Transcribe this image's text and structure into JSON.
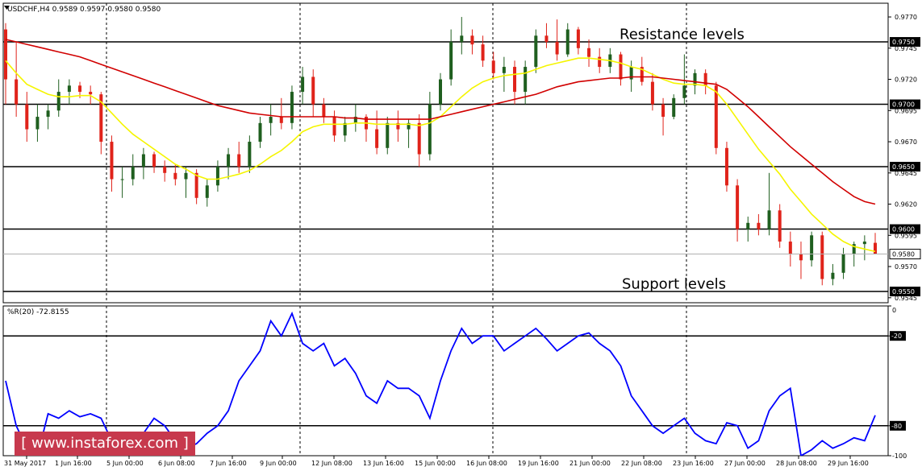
{
  "chart_data": [
    {
      "type": "candlestick",
      "title": "USDCHF,H4 0.9589 0.9597 0.9580 0.9580",
      "ylim": [
        0.9541,
        0.9781
      ],
      "yticks": [
        "0.9770",
        "0.9745",
        "0.9720",
        "0.9695",
        "0.9670",
        "0.9645",
        "0.9620",
        "0.9595",
        "0.9570",
        "0.9545"
      ],
      "xticks": [
        "31 May 2017",
        "1 Jun 16:00",
        "5 Jun 00:00",
        "6 Jun 08:00",
        "7 Jun 16:00",
        "9 Jun 00:00",
        "12 Jun 08:00",
        "13 Jun 16:00",
        "15 Jun 00:00",
        "16 Jun 08:00",
        "19 Jun 16:00",
        "21 Jun 00:00",
        "22 Jun 08:00",
        "23 Jun 16:00",
        "27 Jun 00:00",
        "28 Jun 08:00",
        "29 Jun 16:00"
      ],
      "levels": [
        {
          "value": 0.975,
          "label": "0.9750"
        },
        {
          "value": 0.97,
          "label": "0.9700"
        },
        {
          "value": 0.965,
          "label": "0.9650"
        },
        {
          "value": 0.96,
          "label": "0.9600"
        },
        {
          "value": 0.955,
          "label": "0.9550"
        }
      ],
      "current_price": {
        "value": 0.958,
        "label": "0.9580"
      },
      "annotations": [
        {
          "text": "Resistance levels",
          "price": 0.9753
        },
        {
          "text": "Support levels",
          "price": 0.9553
        }
      ],
      "candles": [
        [
          0.976,
          0.9765,
          0.97,
          0.972
        ],
        [
          0.972,
          0.975,
          0.969,
          0.97
        ],
        [
          0.97,
          0.971,
          0.967,
          0.968
        ],
        [
          0.968,
          0.97,
          0.967,
          0.969
        ],
        [
          0.969,
          0.97,
          0.968,
          0.9695
        ],
        [
          0.9695,
          0.972,
          0.969,
          0.971
        ],
        [
          0.971,
          0.972,
          0.97,
          0.9715
        ],
        [
          0.9715,
          0.9718,
          0.9705,
          0.971
        ],
        [
          0.971,
          0.9715,
          0.97,
          0.9708
        ],
        [
          0.9708,
          0.971,
          0.966,
          0.967
        ],
        [
          0.967,
          0.9675,
          0.963,
          0.964
        ],
        [
          0.964,
          0.965,
          0.9625,
          0.964
        ],
        [
          0.964,
          0.966,
          0.9635,
          0.965
        ],
        [
          0.965,
          0.9665,
          0.964,
          0.966
        ],
        [
          0.966,
          0.9662,
          0.9645,
          0.965
        ],
        [
          0.965,
          0.9655,
          0.9638,
          0.9645
        ],
        [
          0.9645,
          0.9652,
          0.9635,
          0.964
        ],
        [
          0.964,
          0.965,
          0.9625,
          0.9645
        ],
        [
          0.9645,
          0.9648,
          0.962,
          0.9625
        ],
        [
          0.9625,
          0.964,
          0.9618,
          0.9635
        ],
        [
          0.9635,
          0.9655,
          0.963,
          0.965
        ],
        [
          0.965,
          0.9665,
          0.964,
          0.966
        ],
        [
          0.966,
          0.967,
          0.9645,
          0.965
        ],
        [
          0.965,
          0.9675,
          0.9645,
          0.967
        ],
        [
          0.967,
          0.969,
          0.9665,
          0.9685
        ],
        [
          0.9685,
          0.97,
          0.9675,
          0.969
        ],
        [
          0.969,
          0.9705,
          0.968,
          0.9685
        ],
        [
          0.9685,
          0.9715,
          0.968,
          0.971
        ],
        [
          0.971,
          0.973,
          0.97,
          0.9722
        ],
        [
          0.9722,
          0.9728,
          0.969,
          0.97
        ],
        [
          0.97,
          0.9705,
          0.9685,
          0.969
        ],
        [
          0.969,
          0.9695,
          0.967,
          0.9675
        ],
        [
          0.9675,
          0.969,
          0.967,
          0.9685
        ],
        [
          0.9685,
          0.97,
          0.9678,
          0.969
        ],
        [
          0.969,
          0.9692,
          0.967,
          0.968
        ],
        [
          0.968,
          0.9695,
          0.966,
          0.9665
        ],
        [
          0.9665,
          0.969,
          0.966,
          0.9685
        ],
        [
          0.9685,
          0.9695,
          0.967,
          0.968
        ],
        [
          0.968,
          0.9688,
          0.9665,
          0.9685
        ],
        [
          0.9685,
          0.9692,
          0.965,
          0.966
        ],
        [
          0.966,
          0.971,
          0.9655,
          0.97
        ],
        [
          0.97,
          0.9725,
          0.9695,
          0.972
        ],
        [
          0.972,
          0.976,
          0.9715,
          0.975
        ],
        [
          0.975,
          0.977,
          0.974,
          0.9755
        ],
        [
          0.9755,
          0.976,
          0.974,
          0.9748
        ],
        [
          0.9748,
          0.9755,
          0.973,
          0.9735
        ],
        [
          0.9735,
          0.9742,
          0.972,
          0.9725
        ],
        [
          0.9725,
          0.9738,
          0.971,
          0.973
        ],
        [
          0.973,
          0.9735,
          0.97,
          0.971
        ],
        [
          0.971,
          0.9735,
          0.97,
          0.973
        ],
        [
          0.973,
          0.976,
          0.9725,
          0.9755
        ],
        [
          0.9755,
          0.9765,
          0.9745,
          0.975
        ],
        [
          0.975,
          0.9768,
          0.9735,
          0.974
        ],
        [
          0.974,
          0.9765,
          0.9738,
          0.976
        ],
        [
          0.976,
          0.9762,
          0.974,
          0.9745
        ],
        [
          0.9745,
          0.9752,
          0.973,
          0.9738
        ],
        [
          0.9738,
          0.9745,
          0.9725,
          0.973
        ],
        [
          0.973,
          0.9745,
          0.9725,
          0.974
        ],
        [
          0.974,
          0.9742,
          0.9715,
          0.972
        ],
        [
          0.972,
          0.9735,
          0.971,
          0.973
        ],
        [
          0.973,
          0.9738,
          0.9715,
          0.9718
        ],
        [
          0.9718,
          0.9725,
          0.9695,
          0.97
        ],
        [
          0.97,
          0.9705,
          0.9675,
          0.969
        ],
        [
          0.969,
          0.9708,
          0.9688,
          0.9705
        ],
        [
          0.9705,
          0.974,
          0.97,
          0.9715
        ],
        [
          0.9715,
          0.9728,
          0.9708,
          0.9725
        ],
        [
          0.9725,
          0.9728,
          0.9708,
          0.9715
        ],
        [
          0.9715,
          0.9718,
          0.966,
          0.9665
        ],
        [
          0.9665,
          0.967,
          0.963,
          0.9635
        ],
        [
          0.9635,
          0.964,
          0.959,
          0.96
        ],
        [
          0.96,
          0.961,
          0.959,
          0.9605
        ],
        [
          0.9605,
          0.9612,
          0.9595,
          0.96
        ],
        [
          0.96,
          0.9645,
          0.9595,
          0.9615
        ],
        [
          0.9615,
          0.962,
          0.9585,
          0.959
        ],
        [
          0.959,
          0.9598,
          0.957,
          0.958
        ],
        [
          0.958,
          0.959,
          0.956,
          0.9575
        ],
        [
          0.9575,
          0.9598,
          0.957,
          0.9595
        ],
        [
          0.9595,
          0.9598,
          0.9555,
          0.956
        ],
        [
          0.956,
          0.9572,
          0.9555,
          0.9565
        ],
        [
          0.9565,
          0.9585,
          0.956,
          0.958
        ],
        [
          0.958,
          0.959,
          0.957,
          0.9588
        ],
        [
          0.9588,
          0.9595,
          0.9575,
          0.959
        ],
        [
          0.9589,
          0.9597,
          0.958,
          0.958
        ]
      ],
      "series": [
        {
          "name": "fast MA",
          "color": "#f5f500",
          "values": [
            0.9735,
            0.9725,
            0.9716,
            0.9712,
            0.9708,
            0.9706,
            0.9706,
            0.9707,
            0.9707,
            0.9702,
            0.9693,
            0.9684,
            0.9676,
            0.967,
            0.9664,
            0.9658,
            0.9652,
            0.9648,
            0.9643,
            0.964,
            0.964,
            0.9642,
            0.9644,
            0.9647,
            0.9652,
            0.9658,
            0.9663,
            0.967,
            0.9678,
            0.9682,
            0.9684,
            0.9684,
            0.9684,
            0.9685,
            0.9685,
            0.9684,
            0.9684,
            0.9684,
            0.9684,
            0.9683,
            0.9685,
            0.969,
            0.9698,
            0.9706,
            0.9713,
            0.9718,
            0.9721,
            0.9723,
            0.9724,
            0.9725,
            0.9728,
            0.9731,
            0.9733,
            0.9735,
            0.9737,
            0.9737,
            0.9736,
            0.9735,
            0.9733,
            0.973,
            0.9728,
            0.9724,
            0.972,
            0.9717,
            0.9716,
            0.9716,
            0.9715,
            0.971,
            0.97,
            0.9688,
            0.9676,
            0.9664,
            0.9654,
            0.9644,
            0.9632,
            0.9622,
            0.9612,
            0.9604,
            0.9596,
            0.959,
            0.9586,
            0.9584,
            0.9582
          ]
        },
        {
          "name": "slow MA",
          "color": "#d10000",
          "values": [
            0.9752,
            0.975,
            0.9748,
            0.9746,
            0.9744,
            0.9742,
            0.974,
            0.9738,
            0.9735,
            0.9732,
            0.9729,
            0.9726,
            0.9723,
            0.972,
            0.9717,
            0.9714,
            0.9711,
            0.9708,
            0.9705,
            0.9702,
            0.9699,
            0.9697,
            0.9695,
            0.9693,
            0.9692,
            0.9691,
            0.969,
            0.969,
            0.969,
            0.969,
            0.969,
            0.969,
            0.9689,
            0.9689,
            0.9688,
            0.9688,
            0.9688,
            0.9688,
            0.9688,
            0.9688,
            0.9688,
            0.969,
            0.9692,
            0.9694,
            0.9696,
            0.9698,
            0.97,
            0.9702,
            0.9704,
            0.9706,
            0.9708,
            0.9711,
            0.9714,
            0.9716,
            0.9718,
            0.9719,
            0.972,
            0.9721,
            0.9721,
            0.9722,
            0.9722,
            0.9722,
            0.9721,
            0.972,
            0.9719,
            0.9718,
            0.9717,
            0.9716,
            0.9712,
            0.9705,
            0.9698,
            0.969,
            0.9682,
            0.9674,
            0.9666,
            0.9659,
            0.9652,
            0.9645,
            0.9638,
            0.9632,
            0.9626,
            0.9622,
            0.962
          ]
        }
      ]
    },
    {
      "type": "line",
      "title": "%R(20) -72.8155",
      "ylim": [
        -100,
        0
      ],
      "yticks": [
        "0",
        "-20",
        "-80",
        "-100"
      ],
      "levels": [
        {
          "value": -20,
          "label": "-20"
        },
        {
          "value": -80,
          "label": "-80"
        }
      ],
      "series": [
        {
          "name": "%R(20)",
          "color": "#0000ff",
          "values": [
            -50,
            -80,
            -95,
            -100,
            -72,
            -75,
            -70,
            -74,
            -72,
            -75,
            -90,
            -98,
            -95,
            -85,
            -75,
            -80,
            -90,
            -95,
            -92,
            -85,
            -80,
            -70,
            -50,
            -40,
            -30,
            -10,
            -20,
            -5,
            -25,
            -30,
            -25,
            -40,
            -35,
            -45,
            -60,
            -65,
            -50,
            -55,
            -55,
            -60,
            -75,
            -50,
            -30,
            -15,
            -25,
            -20,
            -20,
            -30,
            -25,
            -20,
            -15,
            -22,
            -30,
            -25,
            -20,
            -18,
            -25,
            -30,
            -40,
            -60,
            -70,
            -80,
            -85,
            -80,
            -75,
            -85,
            -90,
            -92,
            -78,
            -80,
            -95,
            -90,
            -70,
            -60,
            -55,
            -100,
            -96,
            -90,
            -95,
            -92,
            -88,
            -90,
            -73
          ]
        }
      ]
    }
  ],
  "watermark": "[ www.instaforex.com ]"
}
